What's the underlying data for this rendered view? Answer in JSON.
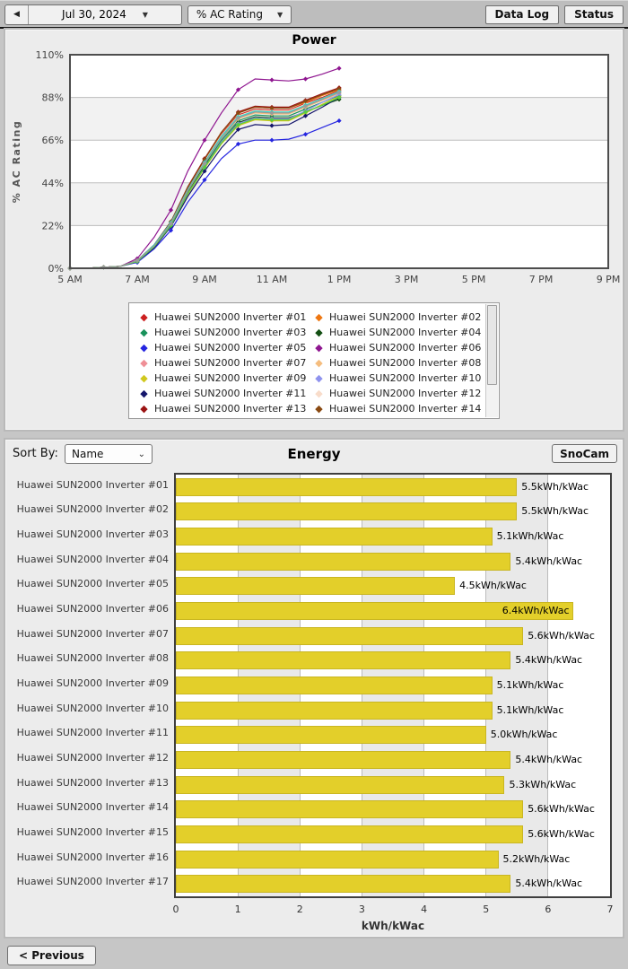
{
  "toolbar": {
    "back_label": "◀",
    "date_label": "Jul 30, 2024",
    "metric_label": "% AC Rating",
    "dropdown_arrow": "▼",
    "data_log_label": "Data Log",
    "status_label": "Status"
  },
  "power_chart": {
    "type": "line",
    "title": "Power",
    "y_label": "% AC Rating",
    "y_tick_values": [
      0,
      22,
      44,
      66,
      88,
      110
    ],
    "y_tick_labels": [
      "0%",
      "22%",
      "44%",
      "66%",
      "88%",
      "110%"
    ],
    "y_max": 110,
    "x_tick_hours": [
      5,
      7,
      9,
      11,
      13,
      15,
      17,
      19,
      21
    ],
    "x_tick_labels": [
      "5 AM",
      "7 AM",
      "9 AM",
      "11 AM",
      "1 PM",
      "3 PM",
      "5 PM",
      "7 PM",
      "9 PM"
    ],
    "x_range_hours": [
      5,
      21
    ],
    "x_hours": [
      5,
      5.5,
      6,
      6.5,
      7,
      7.5,
      8,
      8.5,
      9,
      9.5,
      10,
      10.5,
      11,
      11.5,
      12,
      12.5,
      13
    ],
    "series": [
      {
        "name": "Huawei SUN2000 Inverter #01",
        "color": "#cc2020",
        "values": [
          0,
          0,
          0.5,
          1,
          4,
          12,
          24,
          41,
          55,
          69,
          79,
          82,
          81.5,
          81.5,
          85,
          88,
          91.5
        ]
      },
      {
        "name": "Huawei SUN2000 Inverter #02",
        "color": "#ee7711",
        "values": [
          0,
          0,
          0.5,
          1,
          4,
          12,
          24,
          41.5,
          56,
          70,
          80,
          83,
          82.5,
          82.5,
          85.5,
          89,
          92
        ]
      },
      {
        "name": "Huawei SUN2000 Inverter #03",
        "color": "#18915a",
        "values": [
          0,
          0,
          0.5,
          1,
          4,
          11.5,
          23,
          39.5,
          53,
          66,
          76,
          79,
          78.5,
          78.5,
          82,
          85.5,
          89
        ]
      },
      {
        "name": "Huawei SUN2000 Inverter #04",
        "color": "#134f13",
        "values": [
          0,
          0,
          0.5,
          1,
          3.5,
          11,
          22.5,
          39,
          52.5,
          65,
          75,
          78,
          77.5,
          77.5,
          80.5,
          84,
          87
        ]
      },
      {
        "name": "Huawei SUN2000 Inverter #05",
        "color": "#2525e0",
        "values": [
          0,
          0,
          0.5,
          1,
          3,
          10,
          19.5,
          34,
          45.5,
          56.5,
          64,
          66,
          66,
          66.5,
          69,
          72.5,
          76
        ]
      },
      {
        "name": "Huawei SUN2000 Inverter #06",
        "color": "#8f1690",
        "values": [
          0,
          0,
          0.5,
          1,
          5,
          16,
          30,
          50,
          66,
          80,
          92,
          97.5,
          97,
          96.5,
          97.5,
          100,
          103
        ]
      },
      {
        "name": "Huawei SUN2000 Inverter #07",
        "color": "#ef8f96",
        "values": [
          0,
          0,
          0.5,
          1,
          4,
          11.5,
          23,
          40,
          54,
          67.5,
          77.5,
          80.5,
          80,
          80,
          83.5,
          87,
          90.5
        ]
      },
      {
        "name": "Huawei SUN2000 Inverter #08",
        "color": "#f5bd7e",
        "values": [
          0,
          0,
          0.5,
          1,
          4,
          11.5,
          23,
          40,
          54,
          67,
          77,
          80,
          79.5,
          79.5,
          83,
          86.5,
          90
        ]
      },
      {
        "name": "Huawei SUN2000 Inverter #09",
        "color": "#d0c81e",
        "values": [
          0,
          0,
          0.5,
          1,
          3.5,
          11,
          22,
          38,
          51.5,
          64,
          73.5,
          76.5,
          76,
          76,
          80,
          84.5,
          88.5
        ]
      },
      {
        "name": "Huawei SUN2000 Inverter #10",
        "color": "#8f93ee",
        "values": [
          0,
          0,
          0.5,
          1,
          3.5,
          11,
          22.5,
          38.5,
          52,
          65,
          74.5,
          77.5,
          77,
          77,
          81,
          85.5,
          89.5
        ]
      },
      {
        "name": "Huawei SUN2000 Inverter #11",
        "color": "#15166b",
        "values": [
          0,
          0,
          0.5,
          1,
          3.5,
          10.5,
          21.5,
          37,
          50,
          62,
          71.5,
          74,
          73.5,
          74,
          78.5,
          83,
          88
        ]
      },
      {
        "name": "Huawei SUN2000 Inverter #12",
        "color": "#f8dcca",
        "values": [
          0,
          0,
          0.5,
          1,
          4,
          12,
          23.5,
          41,
          55,
          68.5,
          78.5,
          81.5,
          81,
          81,
          84.5,
          87.5,
          91
        ]
      },
      {
        "name": "Huawei SUN2000 Inverter #13",
        "color": "#9b1313",
        "values": [
          0,
          0,
          0.5,
          1,
          4,
          12,
          24,
          42,
          56.5,
          70,
          80.5,
          83.5,
          83,
          83,
          86.5,
          90,
          93
        ]
      },
      {
        "name": "Huawei SUN2000 Inverter #14",
        "color": "#8a4a12",
        "values": [
          0,
          0,
          0.5,
          1,
          4,
          12,
          24,
          41.5,
          56,
          70,
          80,
          83,
          82.5,
          82.5,
          86,
          89.5,
          92.5
        ]
      },
      {
        "name": "Huawei SUN2000 Inverter #15",
        "color": "#2fd7c9",
        "values": [
          0,
          0,
          0.5,
          1,
          4,
          12,
          23.5,
          40.5,
          54.5,
          68,
          78,
          81,
          80.5,
          80.5,
          84,
          87.5,
          91
        ]
      },
      {
        "name": "Huawei SUN2000 Inverter #16",
        "color": "#55cc44",
        "values": [
          0,
          0,
          0.5,
          1,
          3.5,
          11,
          22,
          38.5,
          52,
          64.5,
          74,
          77,
          76.5,
          76.5,
          80.5,
          84,
          88
        ]
      },
      {
        "name": "Huawei SUN2000 Inverter #17",
        "color": "#9a9a9a",
        "values": [
          0,
          0,
          0.5,
          1,
          4,
          11.5,
          23,
          40,
          54,
          67,
          77.5,
          80.5,
          80,
          80,
          83.5,
          87,
          90.5
        ]
      }
    ]
  },
  "legend": {
    "visible_count": 14
  },
  "energy_chart": {
    "type": "bar",
    "sort_by_label": "Sort By:",
    "sort_value": "Name",
    "title": "Energy",
    "snocam_label": "SnoCam",
    "x_label": "kWh/kWac",
    "x_ticks": [
      0,
      1,
      2,
      3,
      4,
      5,
      6,
      7
    ],
    "x_max": 7,
    "bar_color": "#e3cf2a",
    "rows": [
      {
        "label": "Huawei SUN2000 Inverter #01",
        "value": 5.5,
        "display": "5.5kWh/kWac"
      },
      {
        "label": "Huawei SUN2000 Inverter #02",
        "value": 5.5,
        "display": "5.5kWh/kWac"
      },
      {
        "label": "Huawei SUN2000 Inverter #03",
        "value": 5.1,
        "display": "5.1kWh/kWac"
      },
      {
        "label": "Huawei SUN2000 Inverter #04",
        "value": 5.4,
        "display": "5.4kWh/kWac"
      },
      {
        "label": "Huawei SUN2000 Inverter #05",
        "value": 4.5,
        "display": "4.5kWh/kWac"
      },
      {
        "label": "Huawei SUN2000 Inverter #06",
        "value": 6.4,
        "display": "6.4kWh/kWac"
      },
      {
        "label": "Huawei SUN2000 Inverter #07",
        "value": 5.6,
        "display": "5.6kWh/kWac"
      },
      {
        "label": "Huawei SUN2000 Inverter #08",
        "value": 5.4,
        "display": "5.4kWh/kWac"
      },
      {
        "label": "Huawei SUN2000 Inverter #09",
        "value": 5.1,
        "display": "5.1kWh/kWac"
      },
      {
        "label": "Huawei SUN2000 Inverter #10",
        "value": 5.1,
        "display": "5.1kWh/kWac"
      },
      {
        "label": "Huawei SUN2000 Inverter #11",
        "value": 5.0,
        "display": "5.0kWh/kWac"
      },
      {
        "label": "Huawei SUN2000 Inverter #12",
        "value": 5.4,
        "display": "5.4kWh/kWac"
      },
      {
        "label": "Huawei SUN2000 Inverter #13",
        "value": 5.3,
        "display": "5.3kWh/kWac"
      },
      {
        "label": "Huawei SUN2000 Inverter #14",
        "value": 5.6,
        "display": "5.6kWh/kWac"
      },
      {
        "label": "Huawei SUN2000 Inverter #15",
        "value": 5.6,
        "display": "5.6kWh/kWac"
      },
      {
        "label": "Huawei SUN2000 Inverter #16",
        "value": 5.2,
        "display": "5.2kWh/kWac"
      },
      {
        "label": "Huawei SUN2000 Inverter #17",
        "value": 5.4,
        "display": "5.4kWh/kWac"
      }
    ]
  },
  "footer": {
    "previous_label": "< Previous"
  }
}
